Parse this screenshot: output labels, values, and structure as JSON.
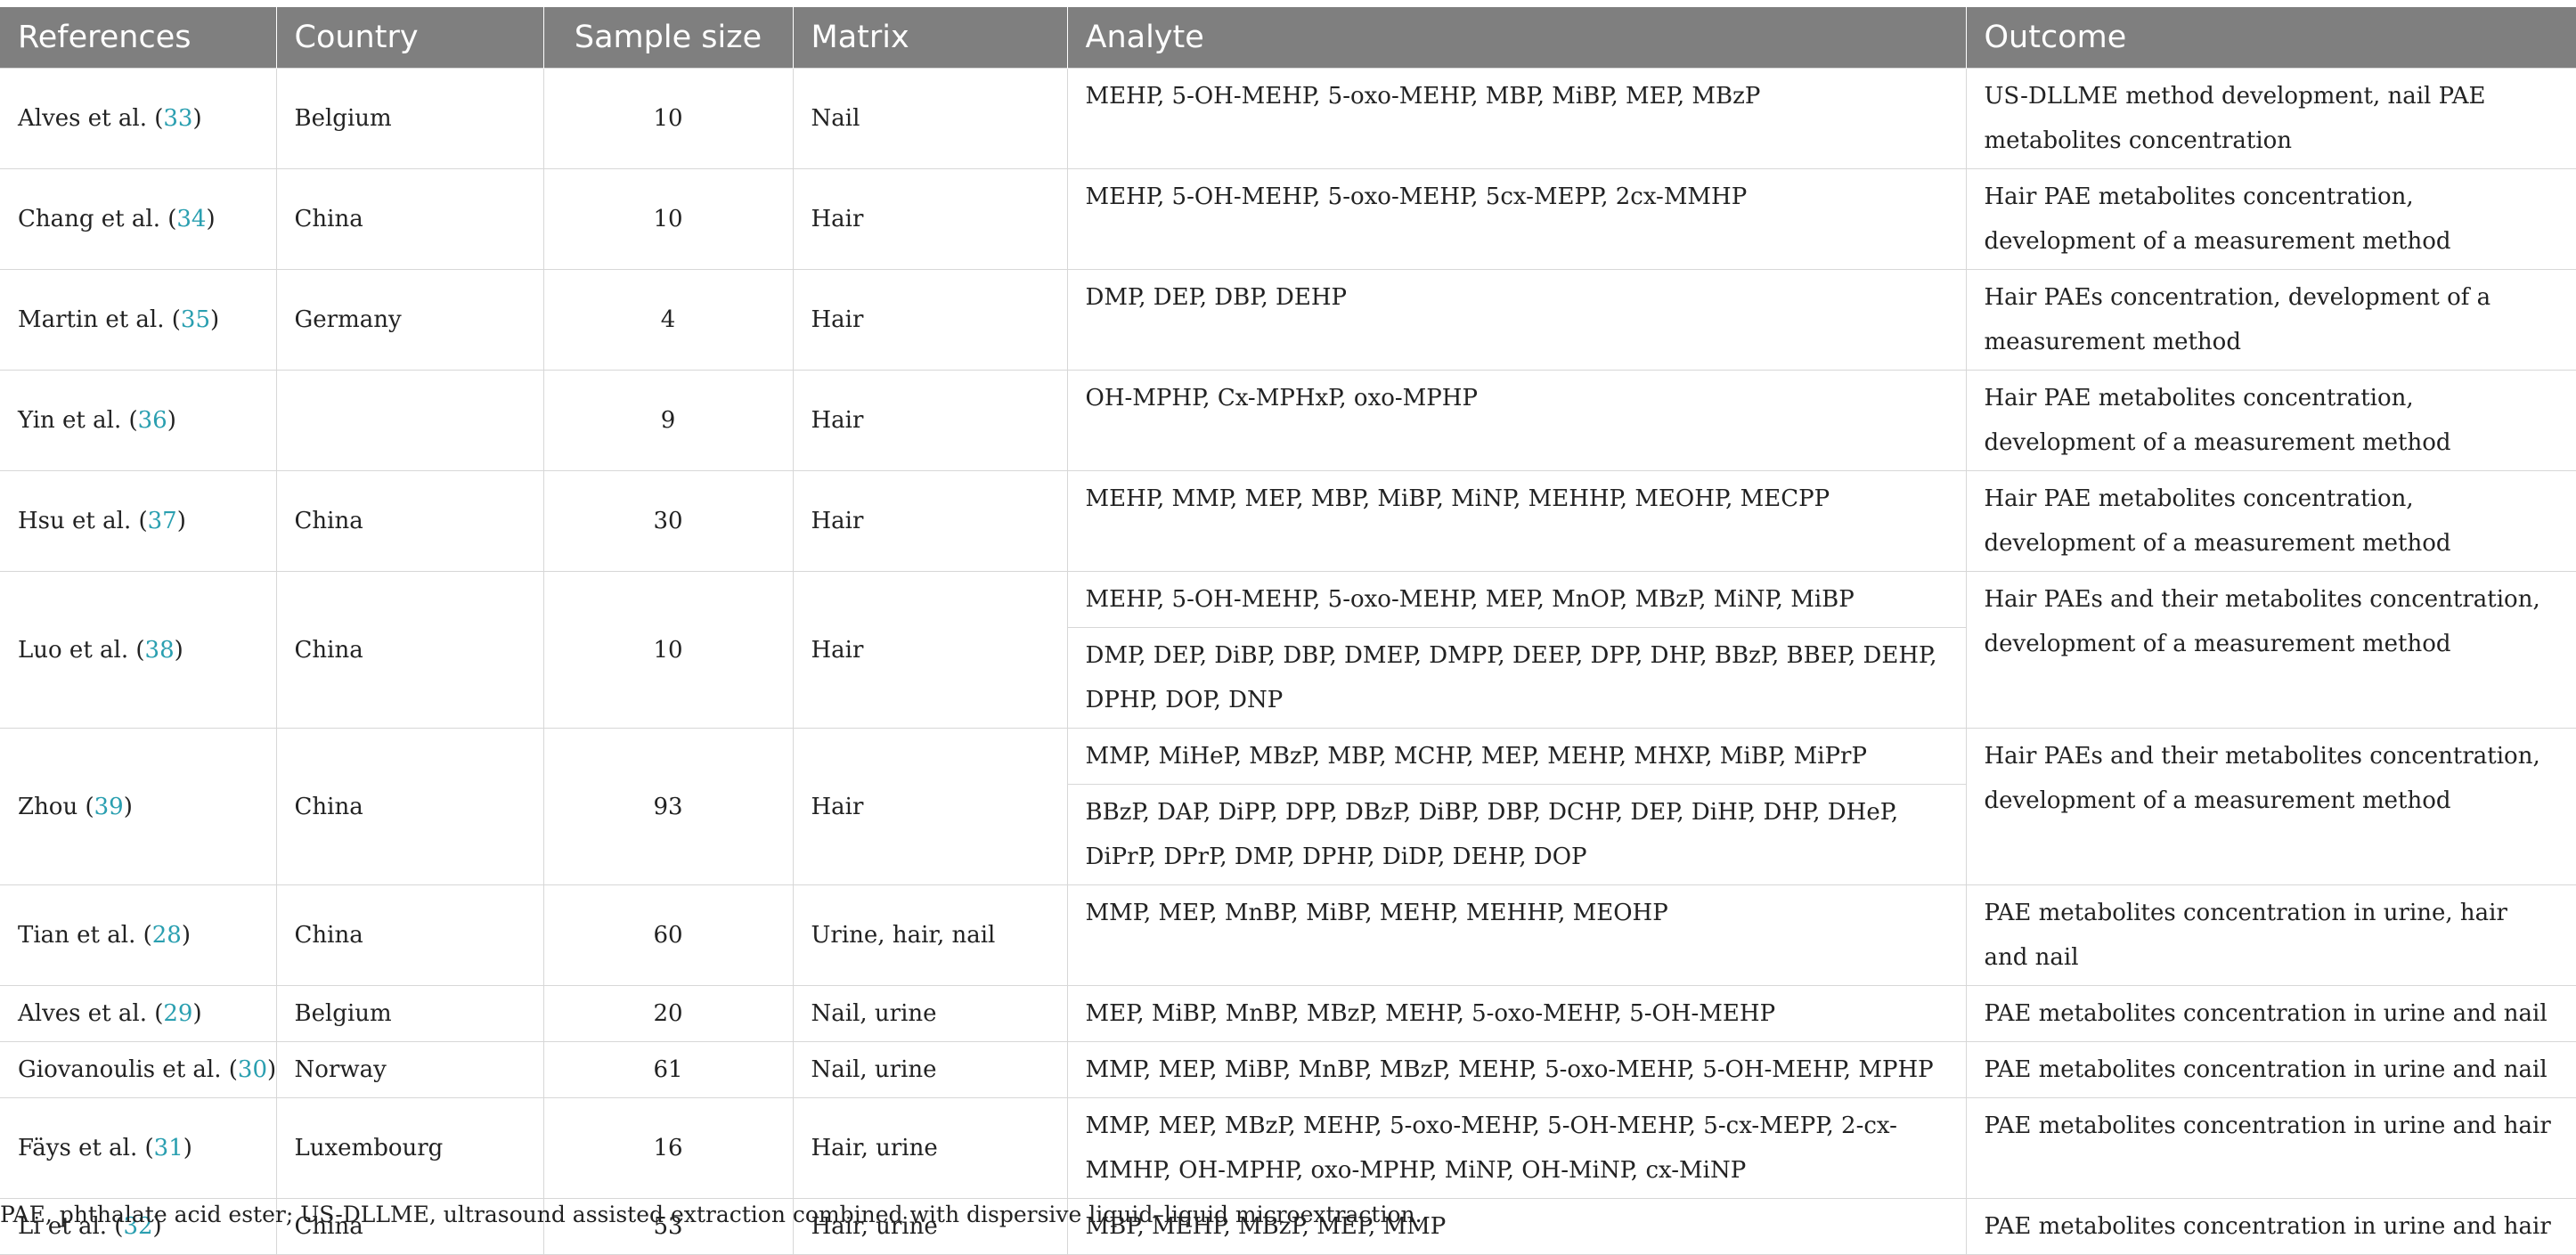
{
  "table": {
    "headers": [
      "References",
      "Country",
      "Sample size",
      "Matrix",
      "Analyte",
      "Outcome"
    ],
    "rows": [
      {
        "ref_author": "Alves et al. (",
        "ref_num": "33",
        "ref_close": ")",
        "country": "Belgium",
        "sample_size": "10",
        "matrix": "Nail",
        "analytes": [
          "MEHP, 5-OH-MEHP, 5-oxo-MEHP, MBP, MiBP, MEP, MBzP"
        ],
        "outcome": "US-DLLME method development, nail PAE metabolites concentration"
      },
      {
        "ref_author": "Chang et al. (",
        "ref_num": "34",
        "ref_close": ")",
        "country": "China",
        "sample_size": "10",
        "matrix": "Hair",
        "analytes": [
          "MEHP, 5-OH-MEHP, 5-oxo-MEHP, 5cx-MEPP, 2cx-MMHP"
        ],
        "outcome": "Hair PAE metabolites concentration, development of a measurement method"
      },
      {
        "ref_author": "Martin et al. (",
        "ref_num": "35",
        "ref_close": ")",
        "country": "Germany",
        "sample_size": "4",
        "matrix": "Hair",
        "analytes": [
          "DMP, DEP, DBP, DEHP"
        ],
        "outcome": "Hair PAEs concentration, development of a measurement method"
      },
      {
        "ref_author": "Yin et al. (",
        "ref_num": "36",
        "ref_close": ")",
        "country": "",
        "sample_size": "9",
        "matrix": "Hair",
        "analytes": [
          "OH-MPHP, Cx-MPHxP, oxo-MPHP"
        ],
        "outcome": "Hair PAE metabolites concentration, development of a measurement method"
      },
      {
        "ref_author": "Hsu et al. (",
        "ref_num": "37",
        "ref_close": ")",
        "country": "China",
        "sample_size": "30",
        "matrix": "Hair",
        "analytes": [
          "MEHP, MMP, MEP, MBP, MiBP, MiNP, MEHHP, MEOHP, MECPP"
        ],
        "outcome": "Hair PAE metabolites concentration, development of a measurement method"
      },
      {
        "ref_author": "Luo et al. (",
        "ref_num": "38",
        "ref_close": ")",
        "country": "China",
        "sample_size": "10",
        "matrix": "Hair",
        "analytes": [
          "MEHP, 5-OH-MEHP, 5-oxo-MEHP, MEP, MnOP, MBzP, MiNP, MiBP",
          "DMP, DEP, DiBP, DBP, DMEP, DMPP, DEEP, DPP, DHP, BBzP, BBEP, DEHP, DPHP, DOP, DNP"
        ],
        "outcome": "Hair PAEs and their metabolites concentration, development of a measurement method"
      },
      {
        "ref_author": "Zhou (",
        "ref_num": "39",
        "ref_close": ")",
        "country": "China",
        "sample_size": "93",
        "matrix": "Hair",
        "analytes": [
          "MMP, MiHeP, MBzP, MBP, MCHP, MEP, MEHP, MHXP, MiBP, MiPrP",
          "BBzP, DAP, DiPP, DPP, DBzP, DiBP, DBP, DCHP, DEP, DiHP, DHP, DHeP, DiPrP, DPrP, DMP, DPHP, DiDP, DEHP, DOP"
        ],
        "outcome": "Hair PAEs and their metabolites concentration, development of a measurement method"
      },
      {
        "ref_author": "Tian et al. (",
        "ref_num": "28",
        "ref_close": ")",
        "country": "China",
        "sample_size": "60",
        "matrix": "Urine, hair, nail",
        "analytes": [
          "MMP, MEP, MnBP, MiBP, MEHP, MEHHP, MEOHP"
        ],
        "outcome": "PAE metabolites concentration in urine, hair and nail"
      },
      {
        "ref_author": "Alves et al. (",
        "ref_num": "29",
        "ref_close": ")",
        "country": "Belgium",
        "sample_size": "20",
        "matrix": "Nail, urine",
        "analytes": [
          "MEP, MiBP, MnBP, MBzP, MEHP, 5-oxo-MEHP, 5-OH-MEHP"
        ],
        "outcome": "PAE metabolites concentration in urine and nail"
      },
      {
        "ref_author": "Giovanoulis et al. (",
        "ref_num": "30",
        "ref_close": ")",
        "country": "Norway",
        "sample_size": "61",
        "matrix": "Nail, urine",
        "analytes": [
          "MMP, MEP, MiBP, MnBP, MBzP, MEHP, 5-oxo-MEHP, 5-OH-MEHP, MPHP"
        ],
        "outcome": "PAE metabolites concentration in urine and nail"
      },
      {
        "ref_author": "Fäys et al. (",
        "ref_num": "31",
        "ref_close": ")",
        "country": "Luxembourg",
        "sample_size": "16",
        "matrix": "Hair, urine",
        "analytes": [
          "MMP, MEP, MBzP, MEHP, 5-oxo-MEHP, 5-OH-MEHP, 5-cx-MEPP, 2-cx-MMHP, OH-MPHP, oxo-MPHP, MiNP, OH-MiNP, cx-MiNP"
        ],
        "outcome": "PAE metabolites concentration in urine and hair"
      },
      {
        "ref_author": "Li et al. (",
        "ref_num": "32",
        "ref_close": ")",
        "country": "China",
        "sample_size": "53",
        "matrix": "Hair, urine",
        "analytes": [
          "MBP, MEHP, MBzP, MEP, MMP"
        ],
        "outcome": "PAE metabolites concentration in urine and hair"
      }
    ]
  },
  "footnote": "PAE, phthalate acid ester; US-DLLME, ultrasound assisted extraction combined with dispersive liquid–liquid microextraction."
}
